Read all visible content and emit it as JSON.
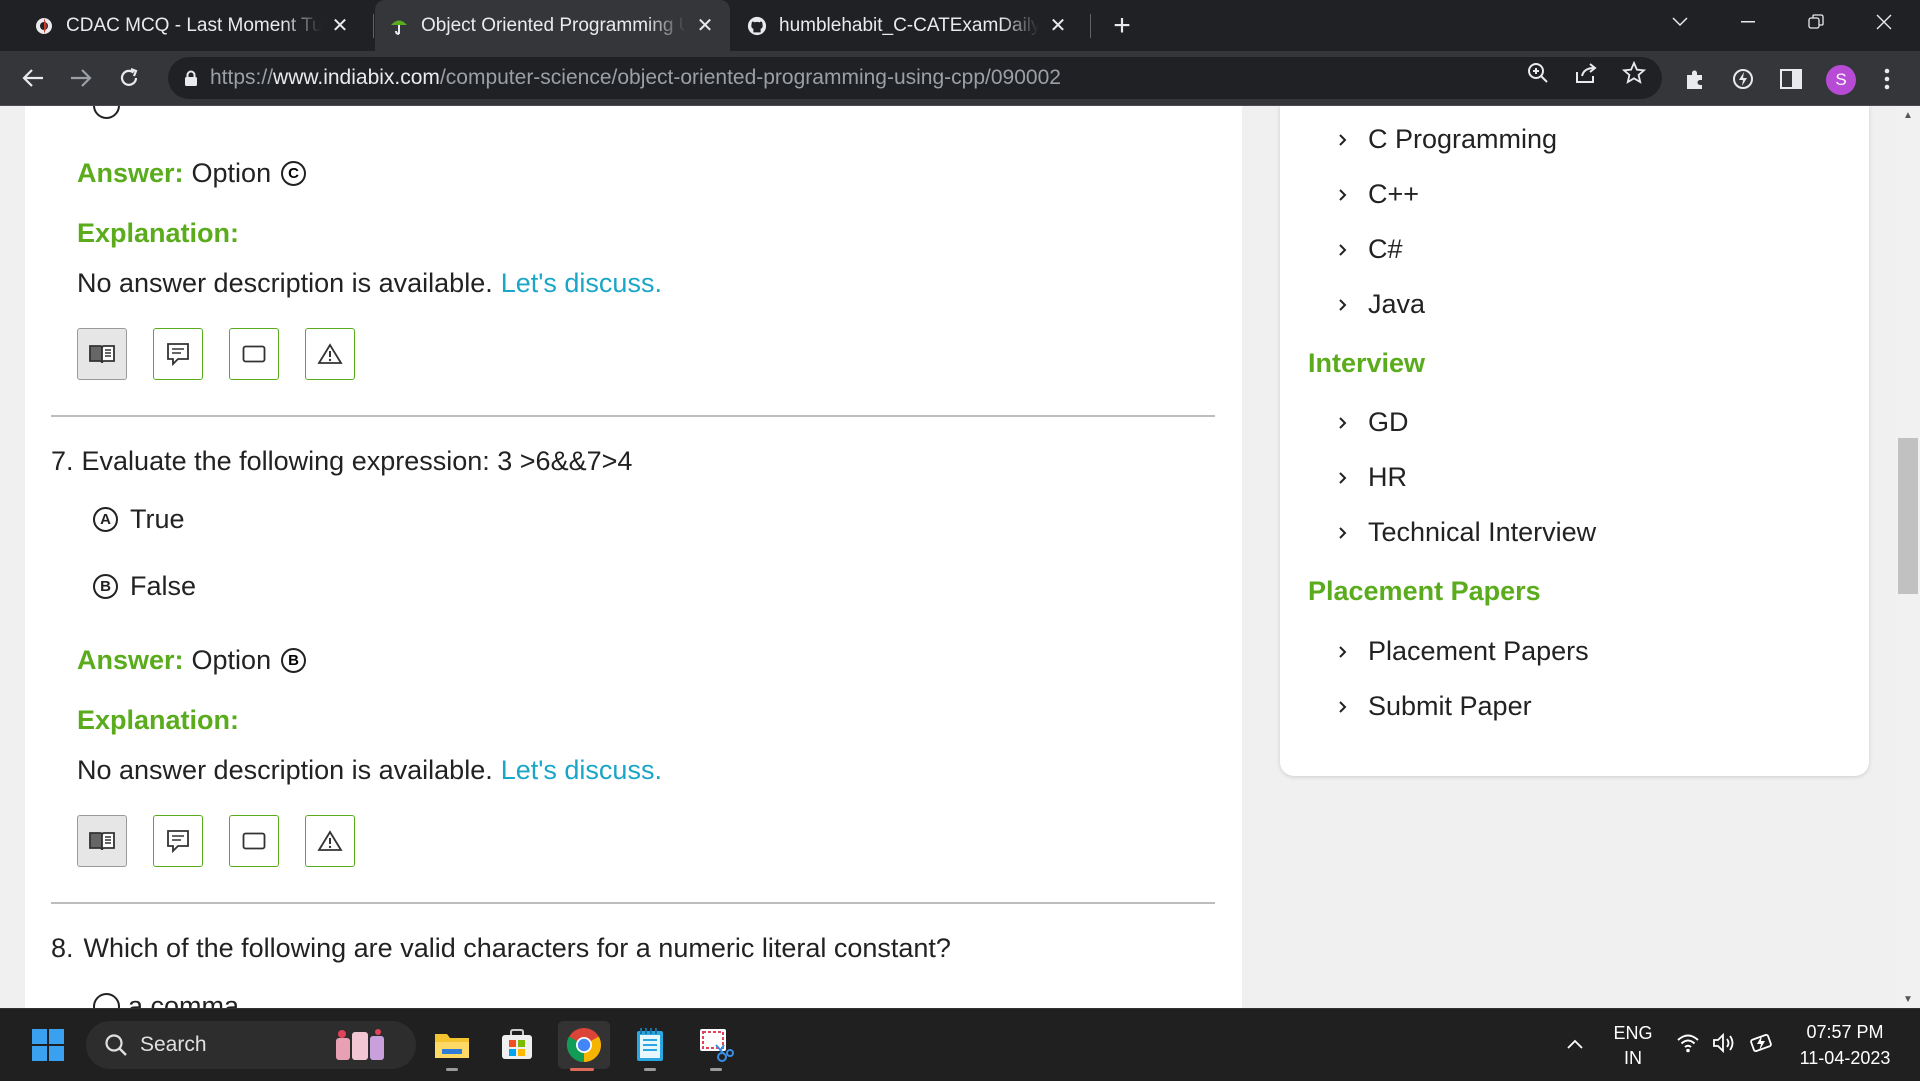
{
  "browser": {
    "tabs": [
      {
        "title": "CDAC MCQ - Last Moment Tuitio",
        "active": false
      },
      {
        "title": "Object Oriented Programming U",
        "active": true
      },
      {
        "title": "humblehabit_C-CATExamDailyPra",
        "active": false
      }
    ],
    "new_tab_label": "+",
    "url_scheme": "https://",
    "url_host": "www.indiabix.com",
    "url_path": "/computer-science/object-oriented-programming-using-cpp/090002",
    "profile_initial": "S"
  },
  "main": {
    "prev_question": {
      "answer_label": "Answer:",
      "option_word": "Option",
      "answer_letter": "C",
      "explanation_label": "Explanation:",
      "explanation_text": "No answer description is available.",
      "discuss_link": "Let's discuss."
    },
    "q7": {
      "number": "7.",
      "text": "Evaluate the following expression: 3 >6&&7>4",
      "options": [
        {
          "letter": "A",
          "text": "True"
        },
        {
          "letter": "B",
          "text": "False"
        }
      ],
      "answer_label": "Answer:",
      "option_word": "Option",
      "answer_letter": "B",
      "explanation_label": "Explanation:",
      "explanation_text": "No answer description is available.",
      "discuss_link": "Let's discuss."
    },
    "q8": {
      "number": "8.",
      "text": "Which of the following are valid characters for a numeric literal constant?",
      "partial_option": "a comma"
    }
  },
  "sidebar": {
    "languages": [
      "C Programming",
      "C++",
      "C#",
      "Java"
    ],
    "interview_heading": "Interview",
    "interview": [
      "GD",
      "HR",
      "Technical Interview"
    ],
    "placement_heading": "Placement Papers",
    "placement": [
      "Placement Papers",
      "Submit Paper"
    ]
  },
  "taskbar": {
    "search_label": "Search",
    "lang_top": "ENG",
    "lang_bottom": "IN",
    "time": "07:57 PM",
    "date": "11-04-2023"
  },
  "colors": {
    "accent_green": "#5aac1d",
    "link_blue": "#1aa6c6",
    "chrome_dark": "#202124",
    "chrome_toolbar": "#35363a"
  }
}
